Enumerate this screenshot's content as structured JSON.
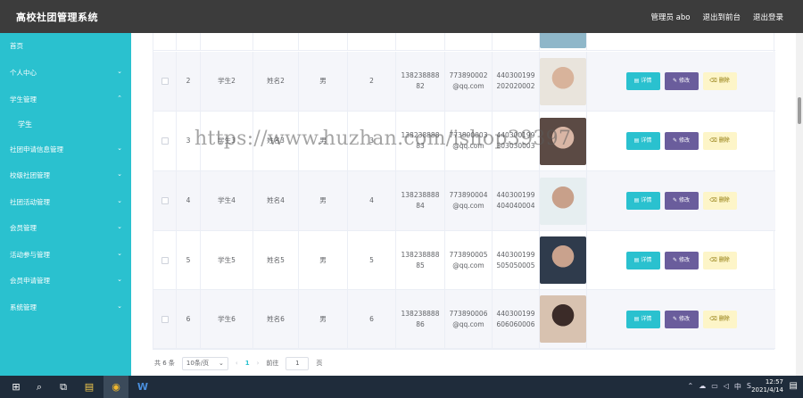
{
  "header": {
    "app_title": "高校社团管理系统",
    "user": "管理员 abo",
    "back_frontend": "退出到前台",
    "logout": "退出登录"
  },
  "sidebar": {
    "items": [
      {
        "label": "首页",
        "chevron": ""
      },
      {
        "label": "个人中心",
        "chevron": "⌄"
      },
      {
        "label": "学生管理",
        "chevron": "⌃"
      },
      {
        "label": "学生",
        "chevron": ""
      },
      {
        "label": "社团申请信息管理",
        "chevron": "⌄"
      },
      {
        "label": "校级社团管理",
        "chevron": "⌄"
      },
      {
        "label": "社团活动管理",
        "chevron": "⌄"
      },
      {
        "label": "会员管理",
        "chevron": "⌄"
      },
      {
        "label": "活动参与管理",
        "chevron": "⌄"
      },
      {
        "label": "会员申请管理",
        "chevron": "⌄"
      },
      {
        "label": "系统管理",
        "chevron": "⌄"
      }
    ]
  },
  "table": {
    "rows": [
      {
        "no": "",
        "account": "",
        "name": "",
        "gender": "",
        "age": "",
        "phone": "",
        "email": "",
        "idcard": "",
        "avatar_colors": [
          "#8fb7c9",
          "#e8d2c0"
        ]
      },
      {
        "no": "2",
        "account": "学生2",
        "name": "姓名2",
        "gender": "男",
        "age": "2",
        "phone": "13823888882",
        "email": "773890002@qq.com",
        "idcard": "440300199202020002",
        "avatar_colors": [
          "#e9e4dc",
          "#d8b39b"
        ]
      },
      {
        "no": "3",
        "account": "学生3",
        "name": "姓名3",
        "gender": "男",
        "age": "3",
        "phone": "13823888883",
        "email": "773890003@qq.com",
        "idcard": "440300199303030003",
        "avatar_colors": [
          "#5b4a44",
          "#d9b6a5"
        ]
      },
      {
        "no": "4",
        "account": "学生4",
        "name": "姓名4",
        "gender": "男",
        "age": "4",
        "phone": "13823888884",
        "email": "773890004@qq.com",
        "idcard": "440300199404040004",
        "avatar_colors": [
          "#e6eef0",
          "#c8a08a"
        ]
      },
      {
        "no": "5",
        "account": "学生5",
        "name": "姓名5",
        "gender": "男",
        "age": "5",
        "phone": "13823888885",
        "email": "773890005@qq.com",
        "idcard": "440300199505050005",
        "avatar_colors": [
          "#2f3b4c",
          "#c9a28d"
        ]
      },
      {
        "no": "6",
        "account": "学生6",
        "name": "姓名6",
        "gender": "男",
        "age": "6",
        "phone": "13823888886",
        "email": "773890006@qq.com",
        "idcard": "440300199606060006",
        "avatar_colors": [
          "#d8c2b0",
          "#3b2b28"
        ]
      }
    ],
    "buttons": {
      "detail": "详情",
      "edit": "修改",
      "delete": "删除"
    }
  },
  "pagination": {
    "total": "共 6 条",
    "page_size": "10条/页",
    "prev": "‹",
    "current": "1",
    "next": "›",
    "goto_label": "前往",
    "goto_value": "1",
    "page_suffix": "页"
  },
  "watermark": "https://www.huzhan.com/ishop39397",
  "taskbar": {
    "start": "⊞",
    "search": "⌕",
    "taskview": "⧉",
    "explorer": "▤",
    "chrome": "◉",
    "word": "W",
    "tray": [
      "⌃",
      "☁",
      "▭",
      "◁",
      "中",
      "S"
    ],
    "time": "12:57",
    "date": "2021/4/14",
    "notif": "▤"
  },
  "colors": {
    "sidebar": "#2ac1cf",
    "topbar": "#3c3c3c",
    "detail_button": "#2ac1cf",
    "edit_button": "#6a5d9c",
    "delete_button": "#fdf5c8"
  }
}
